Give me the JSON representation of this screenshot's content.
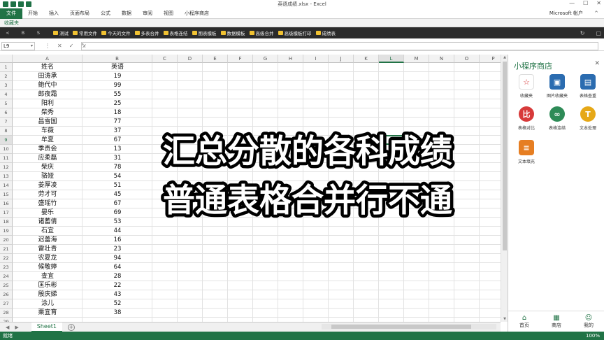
{
  "window": {
    "title": "英语成绩.xlsx - Excel",
    "min": "—",
    "max": "☐",
    "close": "✕"
  },
  "ribbon": {
    "tabs": [
      "文件",
      "开始",
      "插入",
      "页面布局",
      "公式",
      "数据",
      "审阅",
      "视图",
      "小程序商店"
    ],
    "account": "Microsoft 帐户",
    "caret": "^"
  },
  "favbar_title": "收藏夹",
  "bookmarks": {
    "nav": [
      "<",
      "B",
      "S"
    ],
    "items": [
      "测试",
      "常用文件",
      "今天的文件",
      "多表合并",
      "表格连结",
      "图表模板",
      "数据模板",
      "高级合并",
      "高级模板打印",
      "成绩表"
    ],
    "right": [
      "↻",
      "▢"
    ]
  },
  "formula": {
    "cell_ref": "L9",
    "dropdown": "▾",
    "icons": [
      "⋮",
      "✕",
      "✓",
      "fx"
    ],
    "content": ""
  },
  "columns": [
    "A",
    "B",
    "C",
    "D",
    "E",
    "F",
    "G",
    "H",
    "I",
    "J",
    "K",
    "L",
    "M",
    "N",
    "O",
    "P"
  ],
  "selected_col": "L",
  "selected_row": 9,
  "rows": [
    [
      "姓名",
      "英语"
    ],
    [
      "田涛承",
      "19"
    ],
    [
      "鲍代中",
      "99"
    ],
    [
      "郎夜霜",
      "55"
    ],
    [
      "阳利",
      "25"
    ],
    [
      "柴秀",
      "18"
    ],
    [
      "昌雪国",
      "77"
    ],
    [
      "车薇",
      "37"
    ],
    [
      "牟夏",
      "67"
    ],
    [
      "季贵会",
      "13"
    ],
    [
      "应柔磊",
      "31"
    ],
    [
      "柴庆",
      "78"
    ],
    [
      "骆娅",
      "54"
    ],
    [
      "姜厚凌",
      "51"
    ],
    [
      "劳才可",
      "45"
    ],
    [
      "盛瑶竹",
      "67"
    ],
    [
      "晏乐",
      "69"
    ],
    [
      "诸蓄倩",
      "53"
    ],
    [
      "石宜",
      "44"
    ],
    [
      "迟蕾海",
      "16"
    ],
    [
      "雷壮青",
      "23"
    ],
    [
      "农夏龙",
      "94"
    ],
    [
      "候敬婷",
      "64"
    ],
    [
      "查宜",
      "28"
    ],
    [
      "匡乐彬",
      "22"
    ],
    [
      "殷庆娣",
      "43"
    ],
    [
      "涂儿",
      "52"
    ],
    [
      "栗宜育",
      "38"
    ]
  ],
  "sheet": {
    "tab": "Sheet1",
    "add": "+",
    "navs": [
      "◀",
      "▶"
    ]
  },
  "status": {
    "left": "就绪",
    "zoom": "100%"
  },
  "panel": {
    "title": "小程序商店",
    "close": "✕",
    "items": [
      {
        "label": "收藏夹",
        "icon": "star-icon",
        "color": "#ffffff",
        "glyph": "☆"
      },
      {
        "label": "图片收藏夹",
        "icon": "image-icon",
        "color": "#2b6cb0",
        "glyph": "▣"
      },
      {
        "label": "表格查重",
        "icon": "copy-icon",
        "color": "#2b6cb0",
        "glyph": "▤"
      },
      {
        "label": "表格对比",
        "icon": "compare-icon",
        "color": "#d73a3a",
        "glyph": "比"
      },
      {
        "label": "表格连结",
        "icon": "link-icon",
        "color": "#2e8b57",
        "glyph": "∞"
      },
      {
        "label": "文本处理",
        "icon": "text-icon",
        "color": "#e6a817",
        "glyph": "T"
      },
      {
        "label": "文本填充",
        "icon": "doc-icon",
        "color": "#e67e22",
        "glyph": "≡"
      }
    ],
    "footer": [
      {
        "label": "首页",
        "icon": "home-icon",
        "glyph": "⌂"
      },
      {
        "label": "商店",
        "icon": "store-icon",
        "glyph": "▦"
      },
      {
        "label": "我的",
        "icon": "user-icon",
        "glyph": "☺"
      }
    ]
  },
  "overlay": {
    "line1": "汇总分散的各科成绩",
    "line2": "普通表格合并行不通",
    "fill_color": "#ffffff",
    "stroke_color": "#000000"
  }
}
